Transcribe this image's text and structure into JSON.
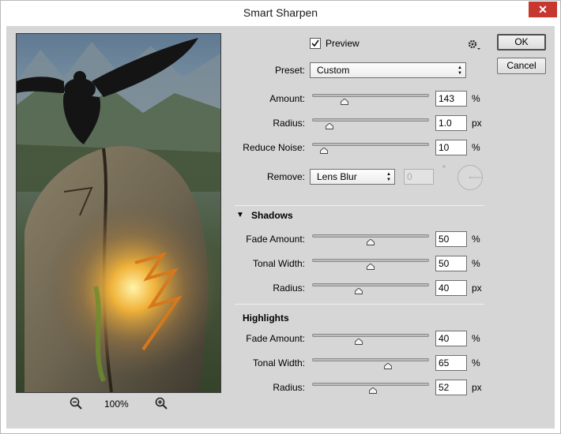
{
  "window": {
    "title": "Smart Sharpen",
    "close_glyph": "✕"
  },
  "preview": {
    "label": "Preview",
    "checked": true
  },
  "buttons": {
    "ok": "OK",
    "cancel": "Cancel"
  },
  "zoom": {
    "level": "100%"
  },
  "preset": {
    "label": "Preset:",
    "value": "Custom"
  },
  "main_sliders": [
    {
      "label": "Amount:",
      "value": "143",
      "unit": "%",
      "fraction": 0.28
    },
    {
      "label": "Radius:",
      "value": "1.0",
      "unit": "px",
      "fraction": 0.15
    },
    {
      "label": "Reduce Noise:",
      "value": "10",
      "unit": "%",
      "fraction": 0.1
    }
  ],
  "remove": {
    "label": "Remove:",
    "value": "Lens Blur",
    "angle": "0",
    "degree_symbol": "°"
  },
  "shadows": {
    "title": "Shadows",
    "sliders": [
      {
        "label": "Fade Amount:",
        "value": "50",
        "unit": "%",
        "fraction": 0.5
      },
      {
        "label": "Tonal Width:",
        "value": "50",
        "unit": "%",
        "fraction": 0.5
      },
      {
        "label": "Radius:",
        "value": "40",
        "unit": "px",
        "fraction": 0.4
      }
    ]
  },
  "highlights": {
    "title": "Highlights",
    "sliders": [
      {
        "label": "Fade Amount:",
        "value": "40",
        "unit": "%",
        "fraction": 0.4
      },
      {
        "label": "Tonal Width:",
        "value": "65",
        "unit": "%",
        "fraction": 0.65
      },
      {
        "label": "Radius:",
        "value": "52",
        "unit": "px",
        "fraction": 0.52
      }
    ]
  },
  "colors": {
    "dialog_bg": "#d6d6d6",
    "close_red": "#c7372f"
  },
  "icons": {
    "zoom_out": "zoom-out-icon",
    "zoom_in": "zoom-in-icon",
    "settings": "gear-icon",
    "collapse": "triangle-down-icon"
  }
}
